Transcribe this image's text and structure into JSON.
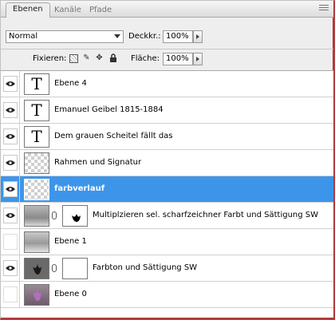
{
  "tabs": [
    {
      "label": "Ebenen",
      "active": true
    },
    {
      "label": "Kanäle",
      "active": false
    },
    {
      "label": "Pfade",
      "active": false
    }
  ],
  "controls": {
    "blend_mode": "Normal",
    "opacity_label": "Deckkr.:",
    "opacity_value": "100%",
    "lock_label": "Fixieren:",
    "fill_label": "Fläche:",
    "fill_value": "100%"
  },
  "layers": [
    {
      "name": "Ebene 4",
      "visible": true,
      "thumb": "text"
    },
    {
      "name": "Emanuel Geibel 1815-1884",
      "visible": true,
      "thumb": "text"
    },
    {
      "name": "Dem grauen Scheitel fällt das",
      "visible": true,
      "thumb": "text"
    },
    {
      "name": "Rahmen und Signatur",
      "visible": true,
      "thumb": "transparent"
    },
    {
      "name": "farbverlauf",
      "visible": true,
      "thumb": "transparent",
      "selected": true
    },
    {
      "name": "Multiplzieren sel. scharfzeichner Farbt und Sättigung SW",
      "visible": true,
      "thumb": "image-gray",
      "mask": "black-flower"
    },
    {
      "name": "Ebene 1",
      "visible": false,
      "thumb": "image-gray"
    },
    {
      "name": "Farbton und Sättigung SW",
      "visible": true,
      "thumb": "image-dark",
      "mask": "white"
    },
    {
      "name": "Ebene 0",
      "visible": false,
      "thumb": "image-color"
    }
  ],
  "colors": {
    "selection": "#3d95ea",
    "frame": "#b43a3a"
  }
}
